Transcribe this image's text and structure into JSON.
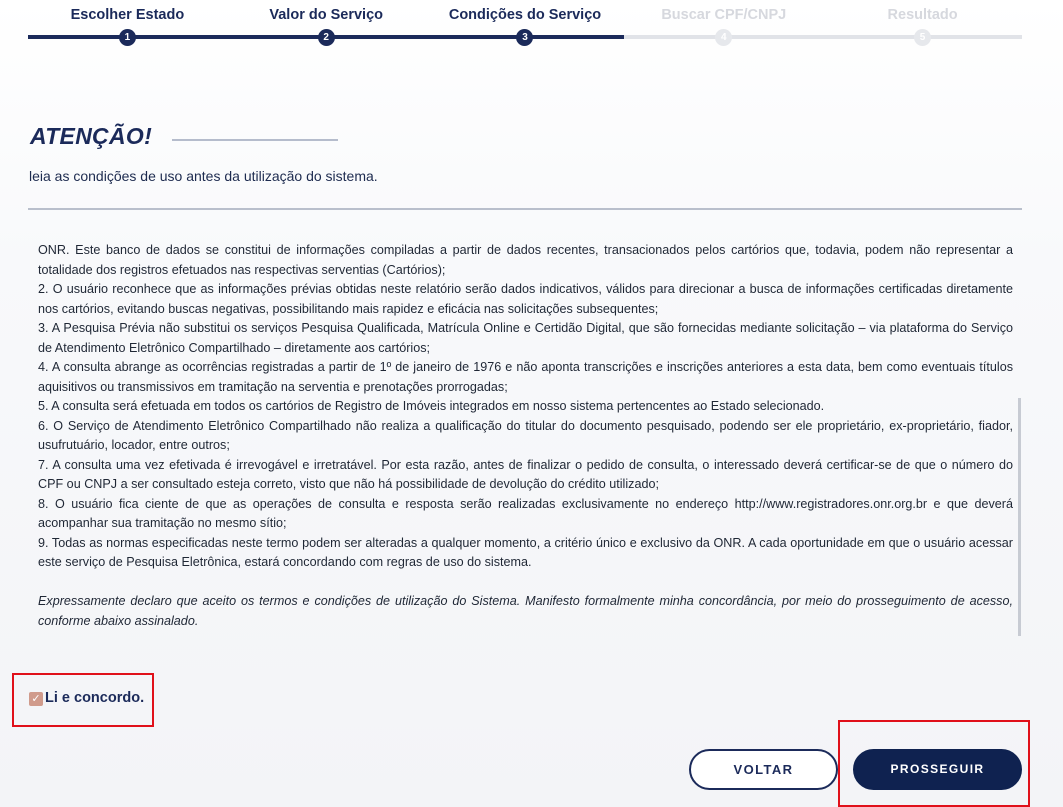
{
  "stepper": {
    "steps": [
      {
        "label": "Escolher Estado",
        "number": "1",
        "status": "done"
      },
      {
        "label": "Valor do Serviço",
        "number": "2",
        "status": "done"
      },
      {
        "label": "Condições do Serviço",
        "number": "3",
        "status": "current"
      },
      {
        "label": "Buscar CPF/CNPJ",
        "number": "4",
        "status": "pending"
      },
      {
        "label": "Resultado",
        "number": "5",
        "status": "pending"
      }
    ]
  },
  "heading": {
    "title": "ATENÇÃO!",
    "subtitle": "leia as condições de uso antes da utilização do sistema."
  },
  "terms": {
    "paragraphs": [
      "ONR. Este banco de dados se constitui de informações compiladas a partir de dados recentes, transacionados pelos cartórios que, todavia, podem não representar a totalidade dos registros efetuados nas respectivas serventias (Cartórios);",
      "2. O usuário reconhece que as informações prévias obtidas neste relatório serão dados indicativos, válidos para direcionar a busca de informações certificadas diretamente nos cartórios, evitando buscas negativas, possibilitando mais rapidez e eficácia nas solicitações subsequentes;",
      "3. A Pesquisa Prévia não substitui os serviços Pesquisa Qualificada, Matrícula Online e Certidão Digital, que são fornecidas mediante solicitação – via plataforma do Serviço de Atendimento Eletrônico Compartilhado – diretamente aos cartórios;",
      "4. A consulta abrange as ocorrências registradas a partir de 1º de janeiro de 1976 e não aponta transcrições e inscrições anteriores a esta data, bem como eventuais títulos aquisitivos ou transmissivos em tramitação na serventia e prenotações prorrogadas;",
      "5. A consulta será efetuada em todos os cartórios de Registro de Imóveis integrados em nosso sistema pertencentes ao Estado selecionado.",
      "6. O Serviço de Atendimento Eletrônico Compartilhado não realiza a qualificação do titular do documento pesquisado, podendo ser ele proprietário, ex-proprietário, fiador, usufrutuário, locador, entre outros;",
      "7. A consulta uma vez efetivada é irrevogável e irretratável. Por esta razão, antes de finalizar o pedido de consulta, o interessado deverá certificar-se de que o número do CPF ou CNPJ a ser consultado esteja correto, visto que não há possibilidade de devolução do crédito utilizado;",
      "8. O usuário fica ciente de que as operações de consulta e resposta serão realizadas exclusivamente no endereço http://www.registradores.onr.org.br e que deverá acompanhar sua tramitação no mesmo sítio;",
      "9. Todas as normas especificadas neste termo podem ser alteradas a qualquer momento, a critério único e exclusivo da ONR. A cada oportunidade em que o usuário acessar este serviço de Pesquisa Eletrônica, estará concordando com regras de uso do sistema."
    ],
    "declaration": "Expressamente declaro que aceito os termos e condições de utilização do Sistema. Manifesto formalmente minha concordância, por meio do prosseguimento de acesso, conforme abaixo assinalado."
  },
  "agreement": {
    "label": "Li e concordo.",
    "checked": true
  },
  "actions": {
    "back_label": "VOLTAR",
    "next_label": "PROSSEGUIR"
  },
  "colors": {
    "primary": "#1b2a5a",
    "highlight": "#e0101a",
    "checkbox": "#d09b8c"
  }
}
